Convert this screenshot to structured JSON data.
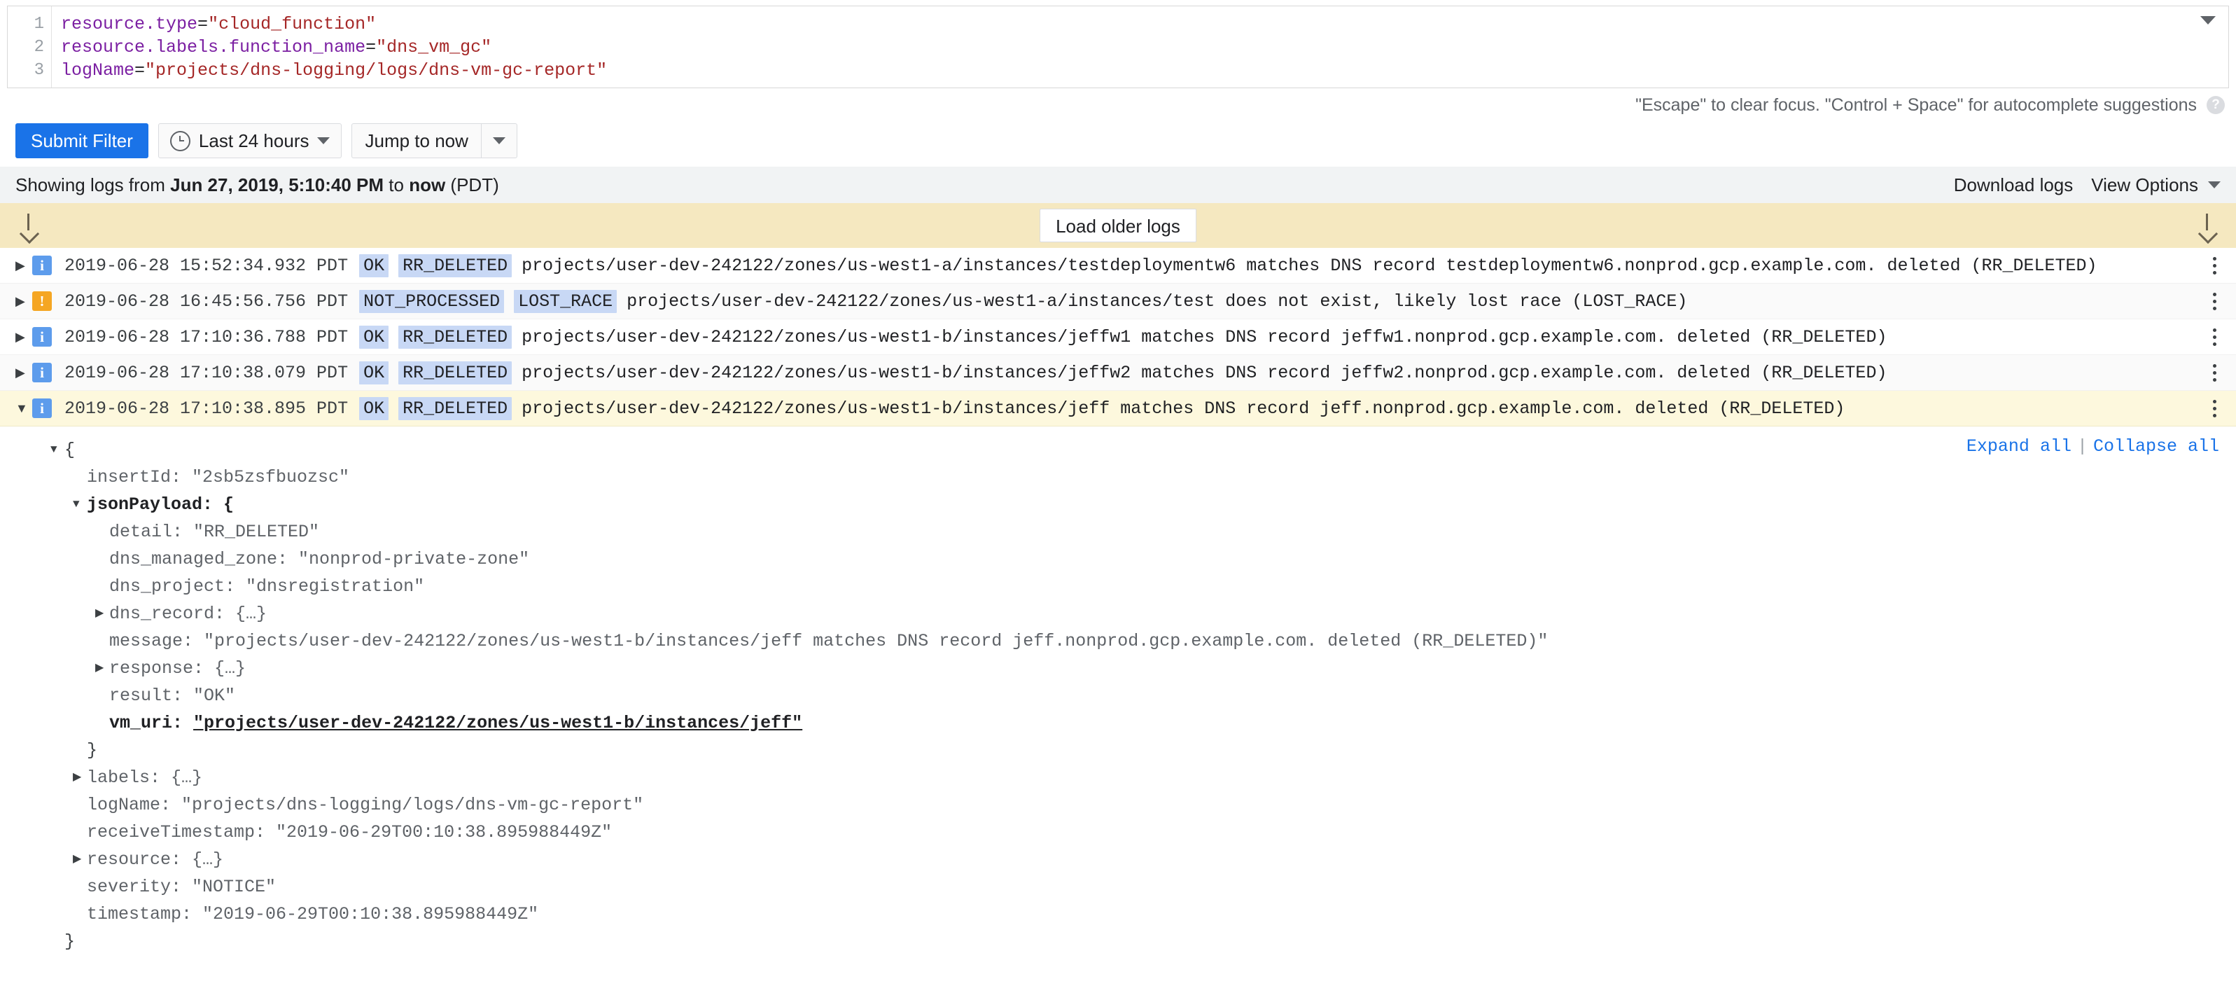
{
  "query_editor": {
    "caret_icon": "chevron-down-icon",
    "lines": [
      {
        "num": "1",
        "field": "resource.type",
        "op": "=",
        "value": "\"cloud_function\""
      },
      {
        "num": "2",
        "field": "resource.labels.function_name",
        "op": "=",
        "value": "\"dns_vm_gc\""
      },
      {
        "num": "3",
        "field": "logName",
        "op": "=",
        "value": "\"projects/dns-logging/logs/dns-vm-gc-report\""
      }
    ]
  },
  "hint": {
    "text": "\"Escape\" to clear focus. \"Control + Space\" for autocomplete suggestions",
    "help_icon": "help-icon",
    "help_glyph": "?"
  },
  "toolbar": {
    "submit_label": "Submit Filter",
    "time_range_label": "Last 24 hours",
    "time_range_icon": "clock-icon",
    "time_range_caret": "chevron-down-icon",
    "jump_label": "Jump to now",
    "jump_caret": "chevron-down-icon"
  },
  "showing_bar": {
    "prefix": "Showing logs from ",
    "start": "Jun 27, 2019, 5:10:40 PM",
    "middle": " to ",
    "end": "now",
    "suffix": " (PDT)",
    "download_label": "Download logs",
    "view_options_label": "View Options",
    "view_options_caret": "chevron-down-icon"
  },
  "load_banner": {
    "button_label": "Load older logs",
    "left_arrow_icon": "arrow-down-icon",
    "right_arrow_icon": "arrow-down-icon",
    "background_color": "#f5e8c0"
  },
  "log_rows": [
    {
      "expanded": false,
      "twisty": "▶",
      "severity": "info",
      "severity_glyph": "i",
      "timestamp": "2019-06-28 15:52:34.932 PDT",
      "chips": [
        "OK",
        "RR_DELETED"
      ],
      "message": "projects/user-dev-242122/zones/us-west1-a/instances/testdeploymentw6 matches DNS record testdeploymentw6.nonprod.gcp.example.com. deleted (RR_DELETED)"
    },
    {
      "expanded": false,
      "twisty": "▶",
      "severity": "warning",
      "severity_glyph": "!",
      "timestamp": "2019-06-28 16:45:56.756 PDT",
      "chips": [
        "NOT_PROCESSED",
        "LOST_RACE"
      ],
      "message": "projects/user-dev-242122/zones/us-west1-a/instances/test does not exist, likely lost race (LOST_RACE)"
    },
    {
      "expanded": false,
      "twisty": "▶",
      "severity": "info",
      "severity_glyph": "i",
      "timestamp": "2019-06-28 17:10:36.788 PDT",
      "chips": [
        "OK",
        "RR_DELETED"
      ],
      "message": "projects/user-dev-242122/zones/us-west1-b/instances/jeffw1 matches DNS record jeffw1.nonprod.gcp.example.com. deleted (RR_DELETED)"
    },
    {
      "expanded": false,
      "twisty": "▶",
      "severity": "info",
      "severity_glyph": "i",
      "timestamp": "2019-06-28 17:10:38.079 PDT",
      "chips": [
        "OK",
        "RR_DELETED"
      ],
      "message": "projects/user-dev-242122/zones/us-west1-b/instances/jeffw2 matches DNS record jeffw2.nonprod.gcp.example.com. deleted (RR_DELETED)"
    },
    {
      "expanded": true,
      "twisty": "▼",
      "severity": "info",
      "severity_glyph": "i",
      "timestamp": "2019-06-28 17:10:38.895 PDT",
      "chips": [
        "OK",
        "RR_DELETED"
      ],
      "message": "projects/user-dev-242122/zones/us-west1-b/instances/jeff matches DNS record jeff.nonprod.gcp.example.com. deleted (RR_DELETED)"
    }
  ],
  "detail": {
    "expand_all_label": "Expand all",
    "separator": "|",
    "collapse_all_label": "Collapse all",
    "lines": [
      {
        "twisty": "▼",
        "indent": 0,
        "text": "{",
        "style": "brace"
      },
      {
        "twisty": "",
        "indent": 1,
        "text": "insertId: \"2sb5zsfbuozsc\"",
        "style": "normal"
      },
      {
        "twisty": "▼",
        "indent": 1,
        "text": "jsonPayload: {",
        "style": "strong"
      },
      {
        "twisty": "",
        "indent": 2,
        "text": "detail: \"RR_DELETED\"",
        "style": "normal"
      },
      {
        "twisty": "",
        "indent": 2,
        "text": "dns_managed_zone: \"nonprod-private-zone\"",
        "style": "normal"
      },
      {
        "twisty": "",
        "indent": 2,
        "text": "dns_project: \"dnsregistration\"",
        "style": "normal"
      },
      {
        "twisty": "▶",
        "indent": 2,
        "text": "dns_record: {…}",
        "style": "normal"
      },
      {
        "twisty": "",
        "indent": 2,
        "text": "message: \"projects/user-dev-242122/zones/us-west1-b/instances/jeff matches DNS record jeff.nonprod.gcp.example.com. deleted (RR_DELETED)\"",
        "style": "normal"
      },
      {
        "twisty": "▶",
        "indent": 2,
        "text": "response: {…}",
        "style": "normal"
      },
      {
        "twisty": "",
        "indent": 2,
        "text": "result: \"OK\"",
        "style": "normal"
      },
      {
        "twisty": "",
        "indent": 2,
        "text": "vm_uri: ",
        "style": "link",
        "link_text": "\"projects/user-dev-242122/zones/us-west1-b/instances/jeff\""
      },
      {
        "twisty": "",
        "indent": 1,
        "text": "}",
        "style": "brace"
      },
      {
        "twisty": "▶",
        "indent": 1,
        "text": "labels: {…}",
        "style": "normal"
      },
      {
        "twisty": "",
        "indent": 1,
        "text": "logName: \"projects/dns-logging/logs/dns-vm-gc-report\"",
        "style": "normal"
      },
      {
        "twisty": "",
        "indent": 1,
        "text": "receiveTimestamp: \"2019-06-29T00:10:38.895988449Z\"",
        "style": "normal"
      },
      {
        "twisty": "▶",
        "indent": 1,
        "text": "resource: {…}",
        "style": "normal"
      },
      {
        "twisty": "",
        "indent": 1,
        "text": "severity: \"NOTICE\"",
        "style": "normal"
      },
      {
        "twisty": "",
        "indent": 1,
        "text": "timestamp: \"2019-06-29T00:10:38.895988449Z\"",
        "style": "normal"
      },
      {
        "twisty": "",
        "indent": 0,
        "text": "}",
        "style": "brace"
      }
    ]
  },
  "colors": {
    "accent": "#1a73e8",
    "banner": "#f5e8c0",
    "selected_row": "#fdf8dd",
    "chip": "#c8d8f5",
    "info": "#5d9cec",
    "warning": "#f5a623",
    "query_field": "#7b1fa2",
    "query_string": "#a52727"
  }
}
